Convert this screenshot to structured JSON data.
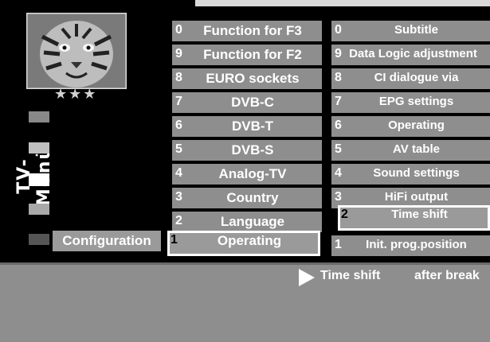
{
  "menu_title": "TV-Menü",
  "stars": "★★★",
  "section_label": "Configuration",
  "column1": [
    {
      "num": "0",
      "label": "Function for F3"
    },
    {
      "num": "9",
      "label": "Function for F2"
    },
    {
      "num": "8",
      "label": "EURO sockets"
    },
    {
      "num": "7",
      "label": "DVB-C"
    },
    {
      "num": "6",
      "label": "DVB-T"
    },
    {
      "num": "5",
      "label": "DVB-S"
    },
    {
      "num": "4",
      "label": "Analog-TV"
    },
    {
      "num": "3",
      "label": "Country"
    },
    {
      "num": "2",
      "label": "Language"
    },
    {
      "num": "1",
      "label": "Operating",
      "selected": true
    }
  ],
  "column2": [
    {
      "num": "0",
      "label": "Subtitle"
    },
    {
      "num": "9",
      "label": "Data Logic adjustment"
    },
    {
      "num": "8",
      "label": "CI dialogue via"
    },
    {
      "num": "7",
      "label": "EPG settings"
    },
    {
      "num": "6",
      "label": "Operating"
    },
    {
      "num": "5",
      "label": "AV table"
    },
    {
      "num": "4",
      "label": "Sound settings"
    },
    {
      "num": "3",
      "label": "HiFi output"
    },
    {
      "num": "2",
      "label": "Time shift",
      "selected": true
    },
    {
      "num": "1",
      "label": "Init. prog.position"
    }
  ],
  "status": {
    "left": "Time shift",
    "right": "after break"
  }
}
